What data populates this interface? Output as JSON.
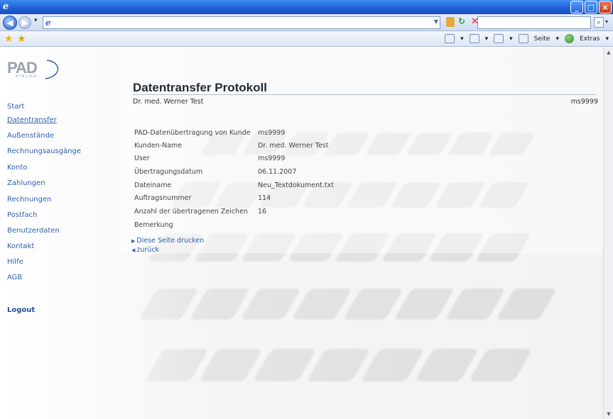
{
  "window": {
    "controls": {
      "minimize": "_",
      "maximize": "□",
      "close": "×"
    }
  },
  "addressbar": {
    "url": ""
  },
  "commandbar": {
    "page_label": "Seite",
    "extras_label": "Extras"
  },
  "logo": {
    "brand": "PAD",
    "sub": "DIALOG"
  },
  "sidebar": {
    "items": [
      {
        "label": "Start"
      },
      {
        "label": "Datentransfer"
      },
      {
        "label": "Außenstände"
      },
      {
        "label": "Rechnungsausgänge"
      },
      {
        "label": "Konto"
      },
      {
        "label": "Zahlungen"
      },
      {
        "label": "Rechnungen"
      },
      {
        "label": "Postfach"
      },
      {
        "label": "Benutzerdaten"
      },
      {
        "label": "Kontakt"
      },
      {
        "label": "Hilfe"
      },
      {
        "label": "AGB"
      }
    ],
    "logout": "Logout",
    "active_index": 1
  },
  "main": {
    "title": "Datentransfer Protokoll",
    "doctor": "Dr. med. Werner Test",
    "user_id": "ms9999",
    "rows": [
      {
        "key": "PAD-Datenübertragung von Kunde",
        "value": "ms9999"
      },
      {
        "key": "Kunden-Name",
        "value": "Dr. med. Werner Test"
      },
      {
        "key": "User",
        "value": "ms9999"
      },
      {
        "key": "Übertragungsdatum",
        "value": "06.11.2007"
      },
      {
        "key": "Dateiname",
        "value": "Neu_Textdokument.txt"
      },
      {
        "key": "Auftragsnummer",
        "value": "114"
      },
      {
        "key": "Anzahl der übertragenen Zeichen",
        "value": "16"
      },
      {
        "key": "Bemerkung",
        "value": ""
      }
    ],
    "links": {
      "print": "Diese Seite drucken",
      "back": "zurück"
    }
  }
}
